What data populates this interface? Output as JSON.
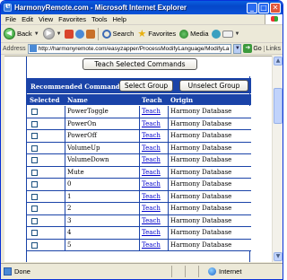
{
  "window": {
    "title": "HarmonyRemote.com - Microsoft Internet Explorer",
    "minimize": "_",
    "maximize": "□",
    "close": "✕"
  },
  "menu": [
    "File",
    "Edit",
    "View",
    "Favorites",
    "Tools",
    "Help"
  ],
  "toolbar": {
    "back_label": "Back",
    "search_label": "Search",
    "favorites_label": "Favorites",
    "media_label": "Media"
  },
  "address": {
    "label": "Address",
    "url": "http://harmonyremote.com/easyzapper/ProcessModifyLanguage/ModifyLa",
    "go_label": "Go",
    "links_label": "Links"
  },
  "page": {
    "teach_button": "Teach Selected Commands",
    "recommended_label": "Recommended Commands:",
    "select_group_button": "Select Group",
    "unselect_group_button": "Unselect Group",
    "columns": [
      "Selected",
      "Name",
      "Teach",
      "Origin"
    ],
    "rows": [
      {
        "name": "PowerToggle",
        "teach": "Teach",
        "origin": "Harmony Database",
        "selected": false
      },
      {
        "name": "PowerOn",
        "teach": "Teach",
        "origin": "Harmony Database",
        "selected": false
      },
      {
        "name": "PowerOff",
        "teach": "Teach",
        "origin": "Harmony Database",
        "selected": false
      },
      {
        "name": "VolumeUp",
        "teach": "Teach",
        "origin": "Harmony Database",
        "selected": false
      },
      {
        "name": "VolumeDown",
        "teach": "Teach",
        "origin": "Harmony Database",
        "selected": false
      },
      {
        "name": "Mute",
        "teach": "Teach",
        "origin": "Harmony Database",
        "selected": false
      },
      {
        "name": "0",
        "teach": "Teach",
        "origin": "Harmony Database",
        "selected": false
      },
      {
        "name": "1",
        "teach": "Teach",
        "origin": "Harmony Database",
        "selected": false
      },
      {
        "name": "2",
        "teach": "Teach",
        "origin": "Harmony Database",
        "selected": false
      },
      {
        "name": "3",
        "teach": "Teach",
        "origin": "Harmony Database",
        "selected": false
      },
      {
        "name": "4",
        "teach": "Teach",
        "origin": "Harmony Database",
        "selected": false
      },
      {
        "name": "5",
        "teach": "Teach",
        "origin": "Harmony Database",
        "selected": false
      }
    ]
  },
  "status": {
    "left_text": "Done",
    "zone_text": "Internet"
  }
}
